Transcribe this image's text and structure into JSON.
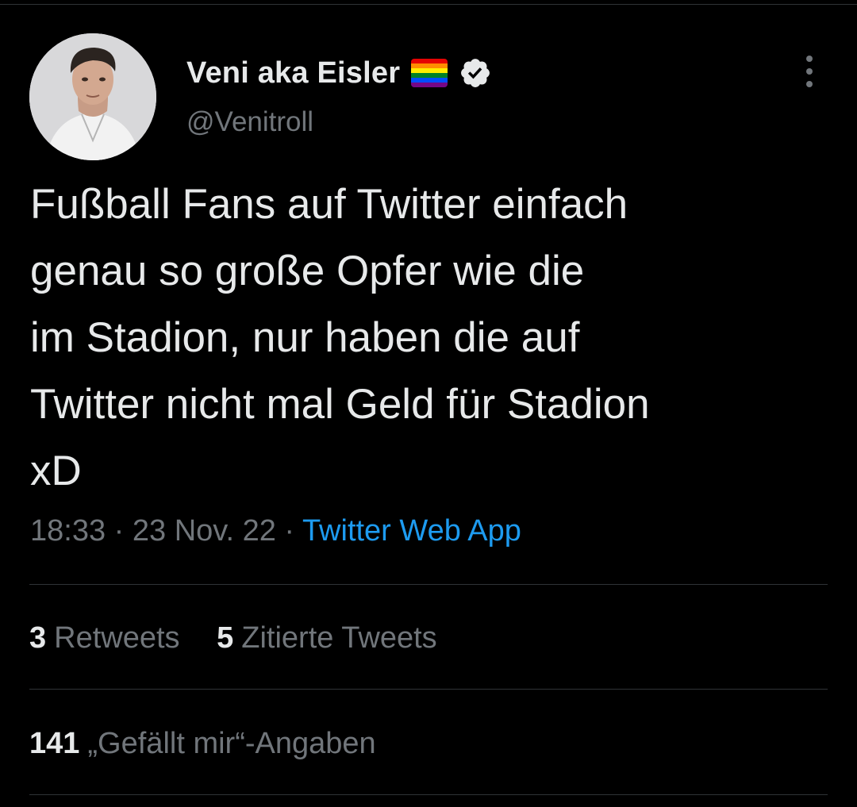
{
  "tweet": {
    "author": {
      "display_name": "Veni aka Eisler",
      "handle": "@Venitroll",
      "flag_icon": "rainbow-flag-icon",
      "verified_icon": "verified-badge-icon"
    },
    "text_lines": [
      "Fußball Fans auf Twitter einfach",
      "genau so große Opfer wie die",
      "im Stadion, nur haben die auf",
      "Twitter nicht mal Geld für Stadion",
      "xD"
    ],
    "time": "18:33",
    "separator": "·",
    "date": "23 Nov. 22",
    "source": "Twitter Web App",
    "stats": {
      "retweets_count": "3",
      "retweets_label": "Retweets",
      "quotes_count": "5",
      "quotes_label": "Zitierte Tweets",
      "likes_count": "141",
      "likes_label": "„Gefällt mir“-Angaben"
    }
  },
  "colors": {
    "background": "#000000",
    "text": "#e7e9ea",
    "secondary": "#71767b",
    "link": "#1d9bf0",
    "divider": "#2f3336",
    "flag": [
      "#e40303",
      "#ff8c00",
      "#ffed00",
      "#008026",
      "#004dff",
      "#750787"
    ]
  }
}
